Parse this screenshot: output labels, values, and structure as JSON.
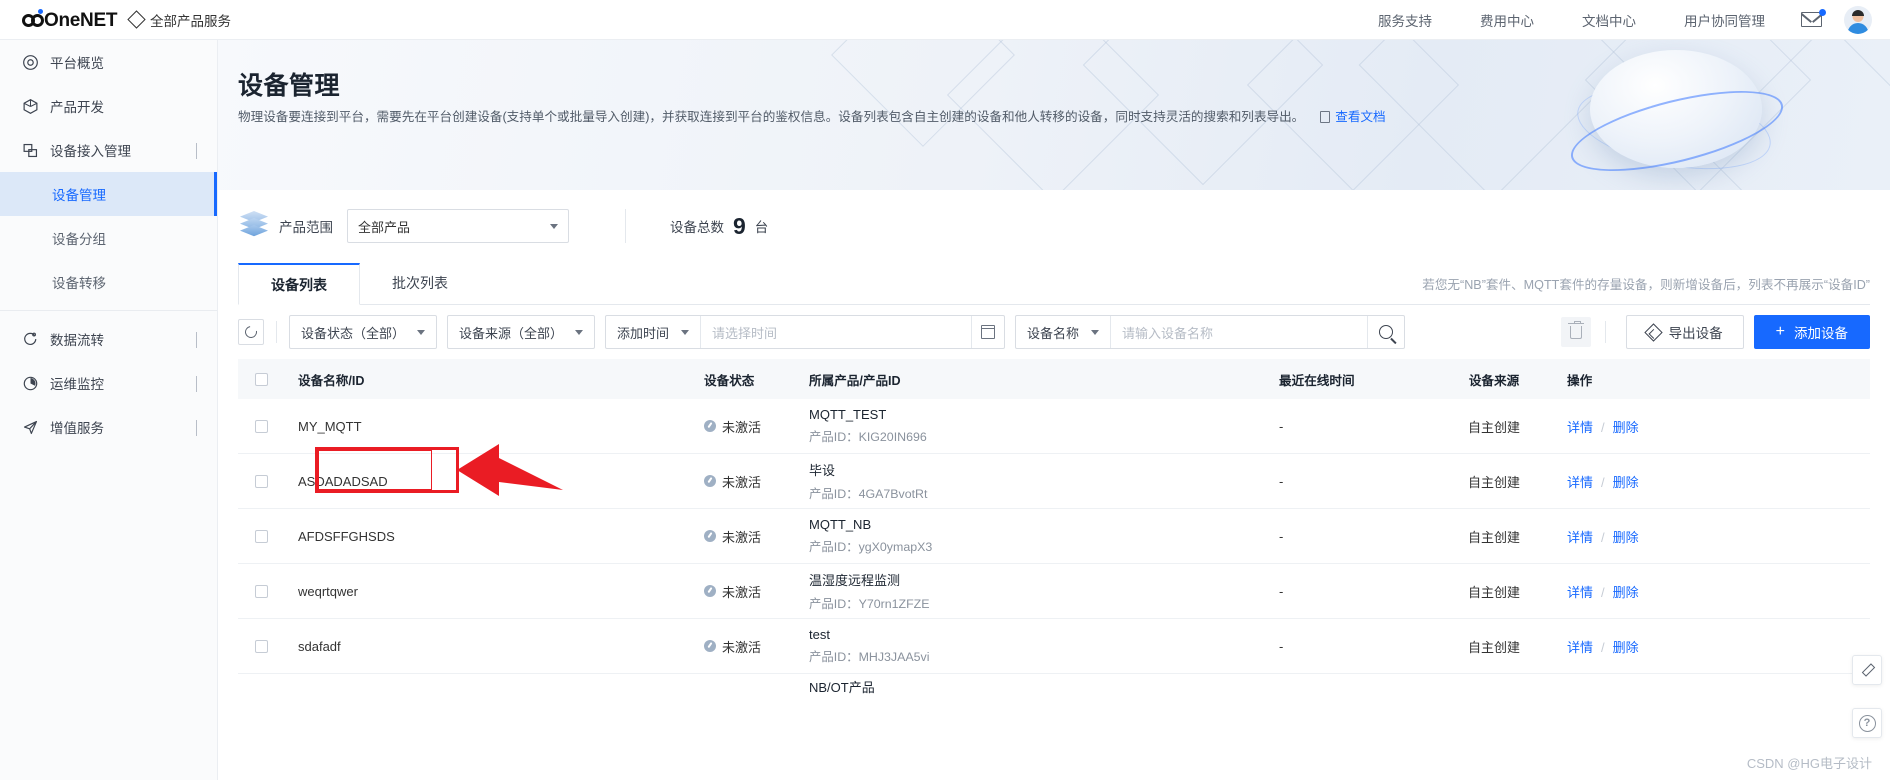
{
  "topbar": {
    "brand": "OneNET",
    "all_products": "全部产品服务",
    "links": [
      "服务支持",
      "费用中心",
      "文档中心",
      "用户协同管理"
    ],
    "mail_icon": "mail-icon",
    "avatar": "user-avatar"
  },
  "sidebar": {
    "items": [
      {
        "label": "平台概览",
        "icon": "dashboard-icon",
        "expandable": false
      },
      {
        "label": "产品开发",
        "icon": "cube-icon",
        "expandable": false
      },
      {
        "label": "设备接入管理",
        "icon": "device-icon",
        "expandable": true,
        "expanded": true
      },
      {
        "label": "数据流转",
        "icon": "flow-icon",
        "expandable": true,
        "expanded": false
      },
      {
        "label": "运维监控",
        "icon": "monitor-icon",
        "expandable": true,
        "expanded": false
      },
      {
        "label": "增值服务",
        "icon": "send-icon",
        "expandable": true,
        "expanded": false
      }
    ],
    "sub_items": [
      {
        "label": "设备管理",
        "active": true
      },
      {
        "label": "设备分组",
        "active": false
      },
      {
        "label": "设备转移",
        "active": false
      }
    ]
  },
  "banner": {
    "title": "设备管理",
    "description": "物理设备要连接到平台，需要先在平台创建设备(支持单个或批量导入创建)，并获取连接到平台的鉴权信息。设备列表包含自主创建的设备和他人转移的设备，同时支持灵活的搜索和列表导出。",
    "doc_link": "查看文档"
  },
  "filter": {
    "scope_label": "产品范围",
    "scope_value": "全部产品",
    "total_label": "设备总数",
    "total_count": "9",
    "total_unit": "台"
  },
  "tabs": {
    "items": [
      {
        "label": "设备列表",
        "active": true
      },
      {
        "label": "批次列表",
        "active": false
      }
    ],
    "note": "若您无“NB”套件、MQTT套件的存量设备，则新增设备后，列表不再展示“设备ID”"
  },
  "toolbar": {
    "refresh_icon": "refresh-icon",
    "status_filter": "设备状态（全部）",
    "source_filter": "设备来源（全部）",
    "time_filter": "添加时间",
    "time_placeholder": "请选择时间",
    "calendar_icon": "calendar-icon",
    "name_filter": "设备名称",
    "name_placeholder": "请输入设备名称",
    "search_icon": "search-icon",
    "delete_icon": "trash-icon",
    "export_label": "导出设备",
    "add_label": "添加设备"
  },
  "table": {
    "columns": [
      "设备名称/ID",
      "设备状态",
      "所属产品/产品ID",
      "最近在线时间",
      "设备来源",
      "操作"
    ],
    "product_id_prefix": "产品ID：",
    "action_detail": "详情",
    "action_delete": "删除",
    "rows": [
      {
        "name": "MY_MQTT",
        "status": "未激活",
        "product": "MQTT_TEST",
        "product_id": "KIG20IN696",
        "last_online": "-",
        "source": "自主创建"
      },
      {
        "name": "ASDADADSAD",
        "status": "未激活",
        "product": "毕设",
        "product_id": "4GA7BvotRt",
        "last_online": "-",
        "source": "自主创建"
      },
      {
        "name": "AFDSFFGHSDS",
        "status": "未激活",
        "product": "MQTT_NB",
        "product_id": "ygX0ymapX3",
        "last_online": "-",
        "source": "自主创建"
      },
      {
        "name": "weqrtqwer",
        "status": "未激活",
        "product": "温湿度远程监测",
        "product_id": "Y70rn1ZFZE",
        "last_online": "-",
        "source": "自主创建"
      },
      {
        "name": "sdafadf",
        "status": "未激活",
        "product": "test",
        "product_id": "MHJ3JAA5vi",
        "last_online": "-",
        "source": "自主创建"
      }
    ]
  },
  "annotation": {
    "highlight_color": "#ea1c24",
    "highlight_target": "MY_MQTT"
  },
  "float_buttons": [
    {
      "icon": "edit-icon"
    },
    {
      "icon": "help-icon",
      "glyph": "?"
    }
  ],
  "watermark": "CSDN @HG电子设计"
}
